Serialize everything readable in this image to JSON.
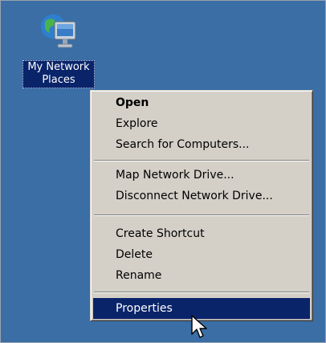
{
  "desktop": {
    "background_color": "#3A6EA5",
    "icon": {
      "name": "network-computer-icon",
      "caption_line1": "My Network",
      "caption_line2": "Places",
      "selected": true
    }
  },
  "context_menu": {
    "groups": [
      [
        {
          "label": "Open",
          "default": true
        },
        {
          "label": "Explore"
        },
        {
          "label": "Search for Computers..."
        }
      ],
      [
        {
          "label": "Map Network Drive..."
        },
        {
          "label": "Disconnect Network Drive..."
        }
      ],
      [
        {
          "label": "Create Shortcut"
        },
        {
          "label": "Delete"
        },
        {
          "label": "Rename"
        }
      ],
      [
        {
          "label": "Properties",
          "highlighted": true
        }
      ]
    ],
    "highlight_color": "#0A246A"
  },
  "cursor": {
    "icon": "arrow-pointer-icon"
  }
}
